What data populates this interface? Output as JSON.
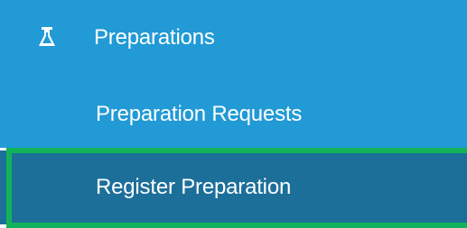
{
  "sidebar": {
    "section": {
      "label": "Preparations",
      "icon": "flask-icon"
    },
    "items": [
      {
        "label": "Preparation Requests",
        "active": false
      },
      {
        "label": "Register Preparation",
        "active": true
      }
    ]
  },
  "colors": {
    "nav_bg": "#219ad6",
    "active_bg": "#1c6f99",
    "highlight_border": "#12b25a",
    "text": "#ffffff"
  }
}
